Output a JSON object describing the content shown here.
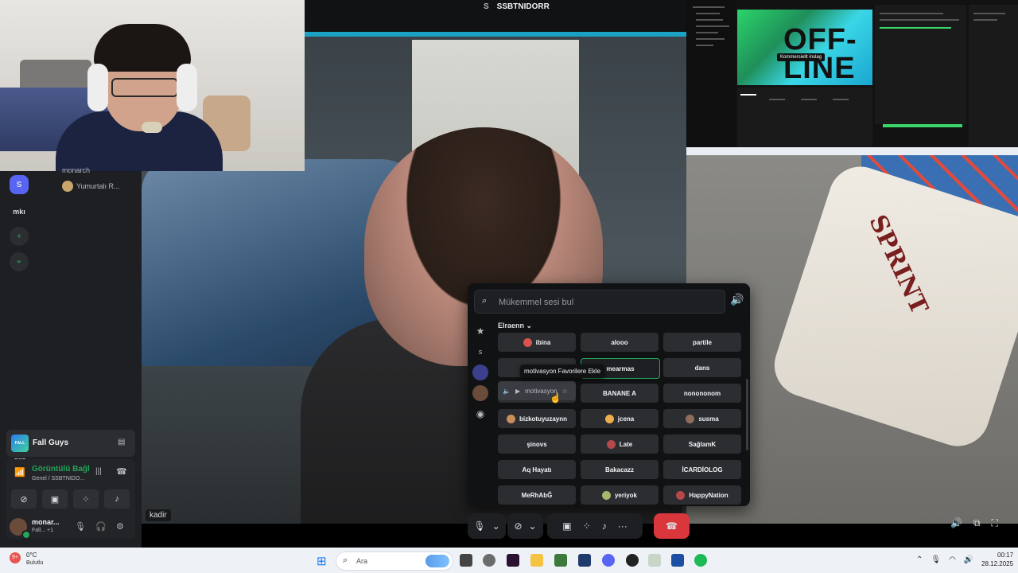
{
  "channel": {
    "server_letter": "S",
    "title": "SSBTNIDORR"
  },
  "video_main": {
    "label": "kadir"
  },
  "screenshare_banner": {
    "text": "OFF-\nLINE",
    "chip": "Kommersiellt inslag"
  },
  "video_right": {
    "pillow_text": "SPRINT"
  },
  "discord": {
    "guilds": [
      {
        "label": "S",
        "icon": "server-icon"
      },
      {
        "label": "mkı",
        "icon": "server-icon"
      },
      {
        "label": "+",
        "icon": "add-server-icon"
      },
      {
        "label": "⌖",
        "icon": "explore-icon"
      }
    ],
    "voice_users": [
      "monarch",
      "Yumurtalı R..."
    ],
    "activity": {
      "logo": "FALL GUYS",
      "name": "Fall Guys"
    },
    "voice": {
      "status": "Görüntülü Bağl",
      "sub": "Genel / SSBTNIDO..."
    },
    "user": {
      "name": "monar...",
      "sub": "Fall... +1"
    }
  },
  "soundboard": {
    "search_placeholder": "Mükemmel sesi bul",
    "user": "Elraenn",
    "tooltip": "motivasyon Favorilere Ekle",
    "hover_label": "motivasyon",
    "sounds": [
      {
        "label": "ibina",
        "emoji": true
      },
      {
        "label": "alooo",
        "emoji": false
      },
      {
        "label": "partile",
        "emoji": false
      },
      {
        "label": "",
        "emoji": false
      },
      {
        "label": "mearmas",
        "emoji": false,
        "selected": true
      },
      {
        "label": "dans",
        "emoji": false
      },
      {
        "label": "",
        "emoji": false
      },
      {
        "label": "BANANE A",
        "emoji": false
      },
      {
        "label": "nonononom",
        "emoji": false
      },
      {
        "label": "bizkotuyuzaynn",
        "emoji": true
      },
      {
        "label": "jcena",
        "emoji": true
      },
      {
        "label": "susma",
        "emoji": true
      },
      {
        "label": "şinovs",
        "emoji": false
      },
      {
        "label": "Late",
        "emoji": true
      },
      {
        "label": "SağlamK",
        "emoji": false
      },
      {
        "label": "Aq Hayatı",
        "emoji": false
      },
      {
        "label": "Bakacazz",
        "emoji": false
      },
      {
        "label": "İCARDİOLOG",
        "emoji": false
      },
      {
        "label": "MeRhAbĞ",
        "emoji": false
      },
      {
        "label": "yeriyok",
        "emoji": true
      },
      {
        "label": "HappyNation",
        "emoji": true
      }
    ]
  },
  "taskbar": {
    "weather_temp": "0°C",
    "weather_desc": "Bulutlu",
    "weather_badge": "9+",
    "search_text": "Ara",
    "time": "00:17",
    "date": "28.12.2025"
  },
  "colors": {
    "accent": "#5865f2",
    "green": "#23a55a",
    "danger": "#da373c",
    "share_border": "#1ba1c4"
  }
}
